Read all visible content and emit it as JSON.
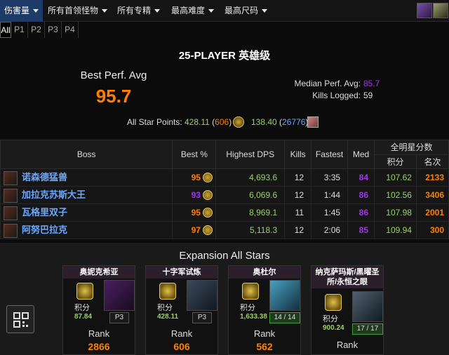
{
  "nav": {
    "items": [
      {
        "label": "伤害量"
      },
      {
        "label": "所有首领怪物"
      },
      {
        "label": "所有专精"
      },
      {
        "label": "最高难度"
      },
      {
        "label": "最高尺码"
      }
    ]
  },
  "tabs": [
    "All",
    "P1",
    "P2",
    "P3",
    "P4"
  ],
  "raid": {
    "title": "25-PLAYER 英雄级"
  },
  "summary": {
    "best_perf_label": "Best Perf. Avg",
    "best_perf_value": "95.7",
    "median_label": "Median Perf. Avg:",
    "median_value": "85.7",
    "kills_label": "Kills Logged:",
    "kills_value": "59",
    "allstar_label": "All Star Points:",
    "allstar_points1": "428.11",
    "allstar_rank1": "606",
    "allstar_points2": "138.40",
    "allstar_rank2": "26776",
    "colors": {
      "legendary": "#ff8000",
      "epic": "#a335ee",
      "uncommon": "#9ad164",
      "link": "#6aa7ff"
    }
  },
  "table": {
    "headers": {
      "boss": "Boss",
      "best": "Best %",
      "dps": "Highest DPS",
      "kills": "Kills",
      "fastest": "Fastest",
      "med": "Med",
      "allstars": "全明星分数",
      "points": "积分",
      "rank": "名次"
    },
    "rows": [
      {
        "name": "诺森德猛兽",
        "best": "95",
        "dps": "4,693.6",
        "kills": "12",
        "fastest": "3:35",
        "med": "84",
        "points": "107.62",
        "rank": "2133"
      },
      {
        "name": "加拉克苏斯大王",
        "best": "93",
        "dps": "6,069.6",
        "kills": "12",
        "fastest": "1:44",
        "med": "86",
        "points": "102.56",
        "rank": "3406"
      },
      {
        "name": "瓦格里双子",
        "best": "95",
        "dps": "8,969.1",
        "kills": "11",
        "fastest": "1:45",
        "med": "86",
        "points": "107.98",
        "rank": "2001"
      },
      {
        "name": "阿努巴拉克",
        "best": "97",
        "dps": "5,118.3",
        "kills": "12",
        "fastest": "2:06",
        "med": "85",
        "points": "109.94",
        "rank": "300"
      }
    ]
  },
  "expansion": {
    "title": "Expansion All Stars",
    "cards": [
      {
        "title": "奥妮克希亚",
        "points_label": "积分",
        "points": "87.84",
        "badge": "P3",
        "rank_label": "Rank",
        "rank": "2866"
      },
      {
        "title": "十字军试炼",
        "points_label": "积分",
        "points": "428.11",
        "badge": "P3",
        "rank_label": "Rank",
        "rank": "606"
      },
      {
        "title": "奥杜尔",
        "points_label": "积分",
        "points": "1,633.38",
        "badge": "14 / 14",
        "rank_label": "Rank",
        "rank": "562"
      },
      {
        "title": "纳克萨玛斯/黑曜圣所/永恒之眼",
        "points_label": "积分",
        "points": "900.24",
        "badge": "17 / 17",
        "rank_label": "Rank",
        "rank": ""
      }
    ]
  }
}
